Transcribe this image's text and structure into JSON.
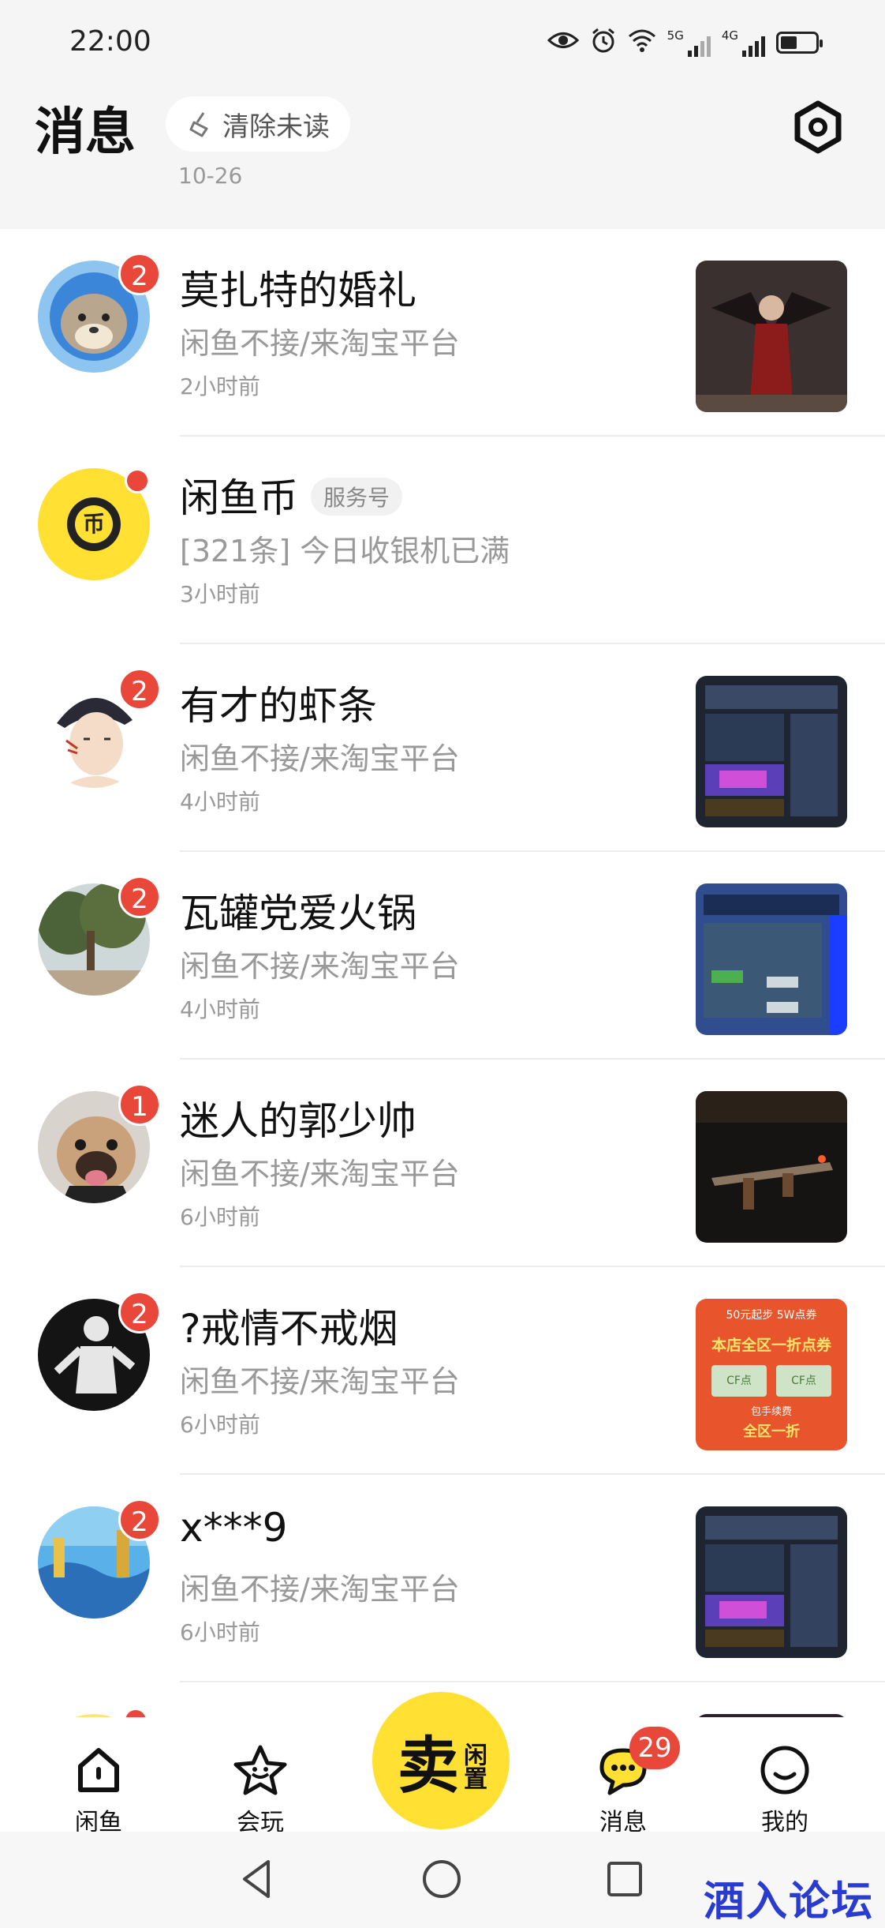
{
  "status_bar": {
    "time": "22:00",
    "net1": "5G",
    "net2": "4G"
  },
  "header": {
    "title": "消息",
    "clear_unread": "清除未读",
    "peek_date": "10-26"
  },
  "conversations": [
    {
      "name": "莫扎特的婚礼",
      "preview": "闲鱼不接/来淘宝平台",
      "time": "2小时前",
      "badge": "2",
      "tag": ""
    },
    {
      "name": "闲鱼币",
      "tag": "服务号",
      "preview": "[321条] 今日收银机已满",
      "time": "3小时前",
      "badge": ""
    },
    {
      "name": "有才的虾条",
      "preview": "闲鱼不接/来淘宝平台",
      "time": "4小时前",
      "badge": "2",
      "tag": ""
    },
    {
      "name": "瓦罐党爱火锅",
      "preview": "闲鱼不接/来淘宝平台",
      "time": "4小时前",
      "badge": "2",
      "tag": ""
    },
    {
      "name": "迷人的郭少帅",
      "preview": "闲鱼不接/来淘宝平台",
      "time": "6小时前",
      "badge": "1",
      "tag": ""
    },
    {
      "name": "?戒情不戒烟",
      "preview": "闲鱼不接/来淘宝平台",
      "time": "6小时前",
      "badge": "2",
      "tag": ""
    },
    {
      "name": "x***9",
      "preview": "闲鱼不接/来淘宝平台",
      "time": "6小时前",
      "badge": "2",
      "tag": ""
    }
  ],
  "coin_avatar_glyph": "币",
  "thumb_texts": {
    "promo_top": "50元起步 5W点券",
    "promo_main": "本店全区一折点券",
    "promo_cf": "CF点",
    "promo_sub": "包手续费",
    "promo_bottom": "全区一折"
  },
  "tabbar": {
    "home": "闲鱼",
    "play": "会玩",
    "sell_main": "卖",
    "sell_sub": "闲置",
    "messages": "消息",
    "messages_badge": "29",
    "me": "我的"
  },
  "watermark": "酒入论坛",
  "colors": {
    "brand_yellow": "#ffe033",
    "badge_red": "#e8473a"
  }
}
